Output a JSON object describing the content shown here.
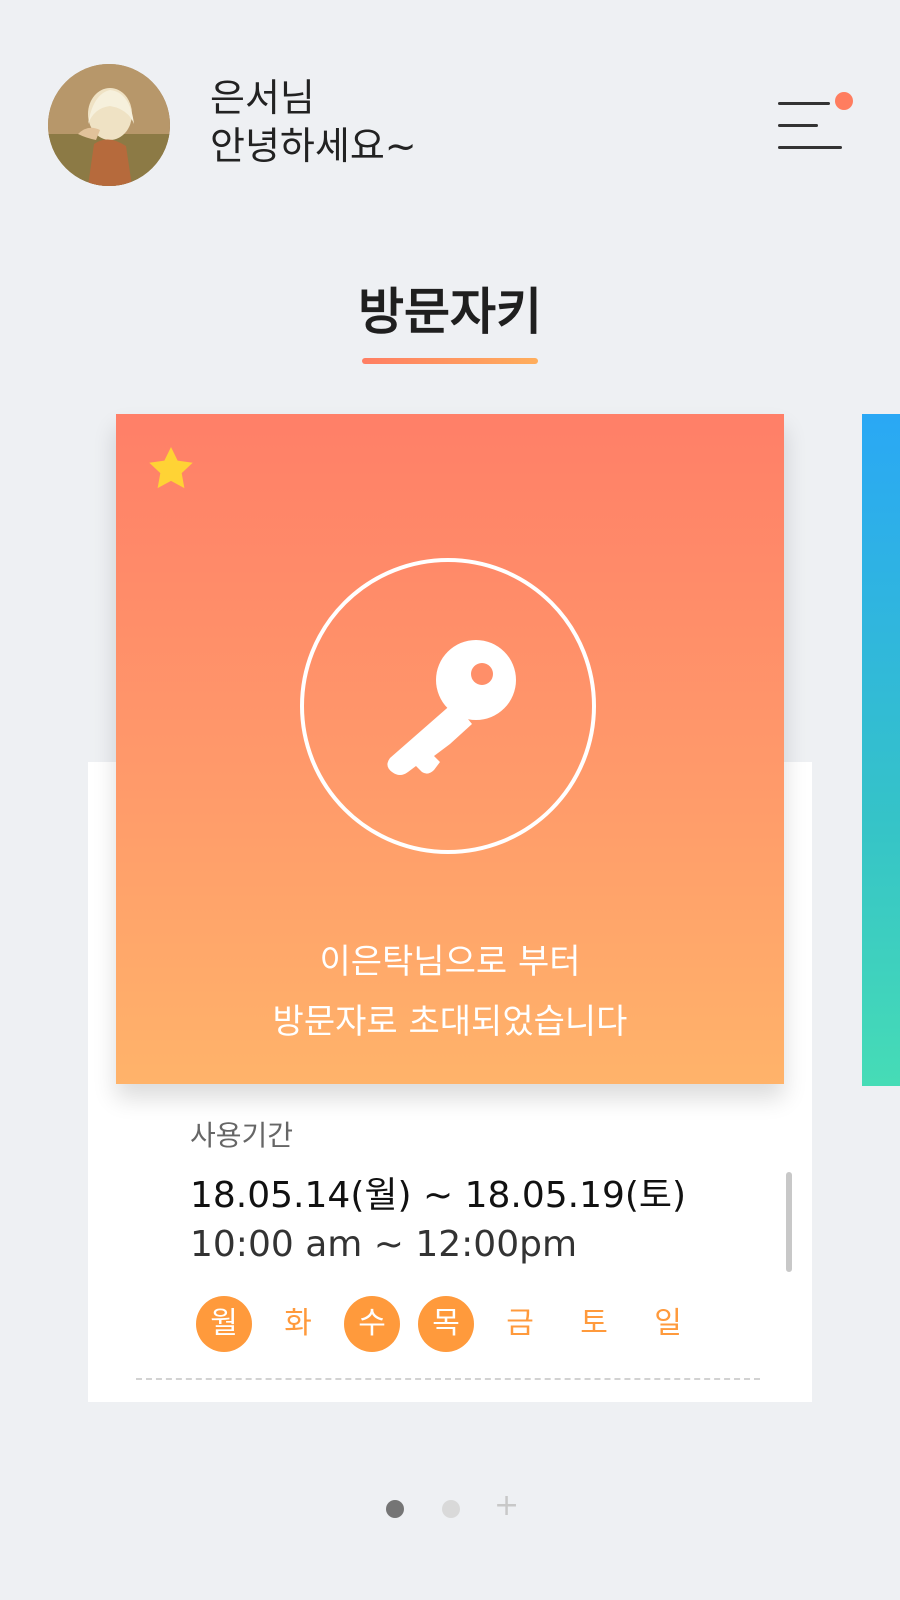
{
  "header": {
    "greeting_line1": "은서님",
    "greeting_line2": "안녕하세요~",
    "menu_notification_color": "#ff7d5f"
  },
  "title": "방문자키",
  "key_card": {
    "favorite_icon": "star-icon",
    "main_icon": "key-icon",
    "invite_line1": "이은탁님으로 부터",
    "invite_line2": "방문자로 초대되었습니다",
    "gradient": [
      "#ff7f68",
      "#ffb36a"
    ]
  },
  "details": {
    "period_label": "사용기간",
    "date_range": "18.05.14(월) ~ 18.05.19(토)",
    "time_range": "10:00 am ~ 12:00pm",
    "days": [
      {
        "label": "월",
        "active": true
      },
      {
        "label": "화",
        "active": false
      },
      {
        "label": "수",
        "active": true
      },
      {
        "label": "목",
        "active": true
      },
      {
        "label": "금",
        "active": false
      },
      {
        "label": "토",
        "active": false
      },
      {
        "label": "일",
        "active": false
      }
    ]
  },
  "pager": {
    "plus": "+"
  },
  "colors": {
    "accent_orange": "#ff9a3c",
    "peek_card": "#2aa8f5"
  }
}
